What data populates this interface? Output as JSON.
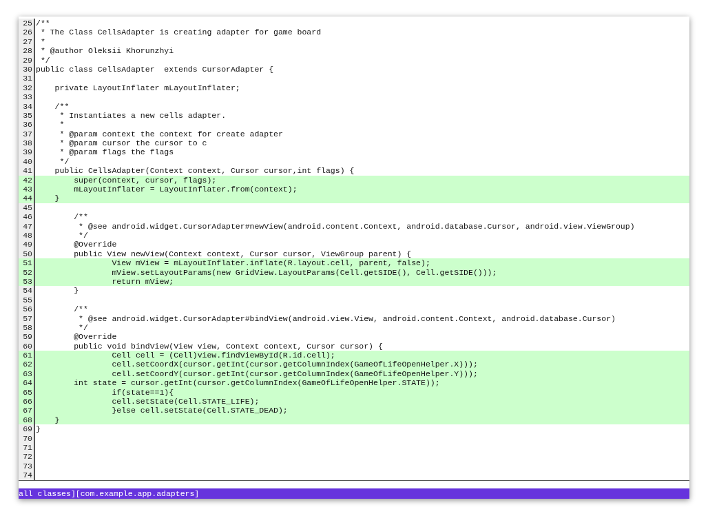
{
  "lines": [
    {
      "number": "25",
      "code": "/**",
      "covered": false
    },
    {
      "number": "26",
      "code": " * The Class CellsAdapter is creating adapter for game board",
      "covered": false
    },
    {
      "number": "27",
      "code": " *",
      "covered": false
    },
    {
      "number": "28",
      "code": " * @author Oleksii Khorunzhyi",
      "covered": false
    },
    {
      "number": "29",
      "code": " */",
      "covered": false
    },
    {
      "number": "30",
      "code": "public class CellsAdapter  extends CursorAdapter {",
      "covered": false
    },
    {
      "number": "31",
      "covered": false
    },
    {
      "number": "32",
      "code": "    private LayoutInflater mLayoutInflater;",
      "covered": false
    },
    {
      "number": "33",
      "covered": false
    },
    {
      "number": "34",
      "code": "    /**",
      "covered": false
    },
    {
      "number": "35",
      "code": "     * Instantiates a new cells adapter.",
      "covered": false
    },
    {
      "number": "36",
      "code": "     *",
      "covered": false
    },
    {
      "number": "37",
      "code": "     * @param context the context for create adapter",
      "covered": false
    },
    {
      "number": "38",
      "code": "     * @param cursor the cursor to c",
      "covered": false
    },
    {
      "number": "39",
      "code": "     * @param flags the flags",
      "covered": false
    },
    {
      "number": "40",
      "code": "     */",
      "covered": false
    },
    {
      "number": "41",
      "code": "    public CellsAdapter(Context context, Cursor cursor,int flags) {",
      "covered": false
    },
    {
      "number": "42",
      "code": "        super(context, cursor, flags);",
      "covered": true
    },
    {
      "number": "43",
      "code": "        mLayoutInflater = LayoutInflater.from(context);",
      "covered": true
    },
    {
      "number": "44",
      "code": "    }",
      "covered": true
    },
    {
      "number": "45",
      "covered": false
    },
    {
      "number": "46",
      "code": "        /**",
      "covered": false
    },
    {
      "number": "47",
      "code": "         * @see android.widget.CursorAdapter#newView(android.content.Context, android.database.Cursor, android.view.ViewGroup)",
      "covered": false
    },
    {
      "number": "48",
      "code": "         */",
      "covered": false
    },
    {
      "number": "49",
      "code": "        @Override",
      "covered": false
    },
    {
      "number": "50",
      "code": "        public View newView(Context context, Cursor cursor, ViewGroup parent) {",
      "covered": false
    },
    {
      "number": "51",
      "code": "                View mView = mLayoutInflater.inflate(R.layout.cell, parent, false);",
      "covered": true
    },
    {
      "number": "52",
      "code": "                mView.setLayoutParams(new GridView.LayoutParams(Cell.getSIDE(), Cell.getSIDE()));",
      "covered": true
    },
    {
      "number": "53",
      "code": "                return mView;",
      "covered": true
    },
    {
      "number": "54",
      "code": "        }",
      "covered": false
    },
    {
      "number": "55",
      "covered": false
    },
    {
      "number": "56",
      "code": "        /**",
      "covered": false
    },
    {
      "number": "57",
      "code": "         * @see android.widget.CursorAdapter#bindView(android.view.View, android.content.Context, android.database.Cursor)",
      "covered": false
    },
    {
      "number": "58",
      "code": "         */",
      "covered": false
    },
    {
      "number": "59",
      "code": "        @Override",
      "covered": false
    },
    {
      "number": "60",
      "code": "        public void bindView(View view, Context context, Cursor cursor) {",
      "covered": false
    },
    {
      "number": "61",
      "code": "                Cell cell = (Cell)view.findViewById(R.id.cell);",
      "covered": true
    },
    {
      "number": "62",
      "code": "                cell.setCoordX(cursor.getInt(cursor.getColumnIndex(GameOfLifeOpenHelper.X)));",
      "covered": true
    },
    {
      "number": "63",
      "code": "                cell.setCoordY(cursor.getInt(cursor.getColumnIndex(GameOfLifeOpenHelper.Y)));",
      "covered": true
    },
    {
      "number": "64",
      "code": "        int state = cursor.getInt(cursor.getColumnIndex(GameOfLifeOpenHelper.STATE));",
      "covered": true
    },
    {
      "number": "65",
      "code": "                if(state==1){",
      "covered": true
    },
    {
      "number": "66",
      "code": "                cell.setState(Cell.STATE_LIFE);",
      "covered": true
    },
    {
      "number": "67",
      "code": "                }else cell.setState(Cell.STATE_DEAD);",
      "covered": true
    },
    {
      "number": "68",
      "code": "    }",
      "covered": true
    },
    {
      "number": "69",
      "code": "}",
      "covered": false
    },
    {
      "number": "70",
      "covered": false
    },
    {
      "number": "71",
      "covered": false
    },
    {
      "number": "72",
      "covered": false
    },
    {
      "number": "73",
      "covered": false
    },
    {
      "number": "74",
      "covered": false
    }
  ],
  "status_bar": "all classes][com.example.app.adapters]"
}
